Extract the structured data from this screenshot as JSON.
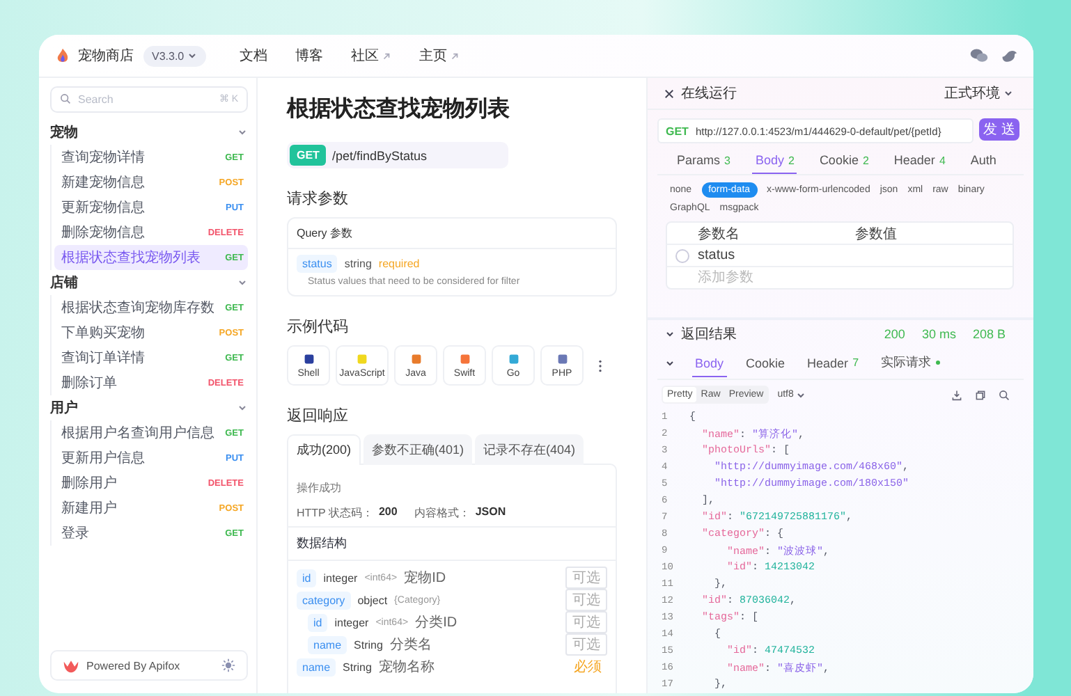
{
  "header": {
    "title": "宠物商店",
    "version": "V3.3.0",
    "nav": [
      {
        "label": "文档",
        "external": false
      },
      {
        "label": "博客",
        "external": false
      },
      {
        "label": "社区",
        "external": true
      },
      {
        "label": "主页",
        "external": true
      }
    ]
  },
  "sidebar": {
    "search": {
      "placeholder": "Search",
      "shortcut": "⌘ K"
    },
    "groups": [
      {
        "title": "宠物",
        "expanded": true,
        "items": [
          {
            "label": "查询宠物详情",
            "method": "GET",
            "color": "#3fb950",
            "selected": false
          },
          {
            "label": "新建宠物信息",
            "method": "POST",
            "color": "#f5a623",
            "selected": false
          },
          {
            "label": "更新宠物信息",
            "method": "PUT",
            "color": "#3b8ff0",
            "selected": false
          },
          {
            "label": "删除宠物信息",
            "method": "DELETE",
            "color": "#f2546b",
            "selected": false
          },
          {
            "label": "根据状态查找宠物列表",
            "method": "GET",
            "color": "#3fb950",
            "selected": true
          }
        ]
      },
      {
        "title": "店铺",
        "expanded": true,
        "items": [
          {
            "label": "根据状态查询宠物库存数",
            "method": "GET",
            "color": "#3fb950",
            "selected": false
          },
          {
            "label": "下单购买宠物",
            "method": "POST",
            "color": "#f5a623",
            "selected": false
          },
          {
            "label": "查询订单详情",
            "method": "GET",
            "color": "#3fb950",
            "selected": false
          },
          {
            "label": "删除订单",
            "method": "DELETE",
            "color": "#f2546b",
            "selected": false
          }
        ]
      },
      {
        "title": "用户",
        "expanded": true,
        "items": [
          {
            "label": "根据用户名查询用户信息",
            "method": "GET",
            "color": "#3fb950",
            "selected": false
          },
          {
            "label": "更新用户信息",
            "method": "PUT",
            "color": "#3b8ff0",
            "selected": false
          },
          {
            "label": "删除用户",
            "method": "DELETE",
            "color": "#f2546b",
            "selected": false
          },
          {
            "label": "新建用户",
            "method": "POST",
            "color": "#f5a623",
            "selected": false
          },
          {
            "label": "登录",
            "method": "GET",
            "color": "#3fb950",
            "selected": false
          }
        ]
      }
    ],
    "footer": "Powered By Apifox"
  },
  "doc": {
    "title": "根据状态查找宠物列表",
    "method": "GET",
    "path": "/pet/findByStatus",
    "params_heading": "请求参数",
    "query_title": "Query 参数",
    "params": [
      {
        "name": "status",
        "type": "string",
        "requirement": "required",
        "description": "Status values that need to be considered for filter"
      }
    ],
    "code_heading": "示例代码",
    "languages": [
      "Shell",
      "JavaScript",
      "Java",
      "Swift",
      "Go",
      "PHP"
    ],
    "response_heading": "返回响应",
    "response_tabs": [
      {
        "label": "成功(200)",
        "selected": true
      },
      {
        "label": "参数不正确(401)",
        "selected": false
      },
      {
        "label": "记录不存在(404)",
        "selected": false
      }
    ],
    "response_desc": "操作成功",
    "status_label": "HTTP 状态码：",
    "status_value": "200",
    "format_label": "内容格式：",
    "format_value": "JSON",
    "schema_heading": "数据结构",
    "fields": [
      {
        "name": "id",
        "type": "integer",
        "format": "<int64>",
        "description": "宠物ID",
        "requirement": "可选",
        "required": false
      },
      {
        "name": "category",
        "type": "object",
        "format": "{Category}",
        "requirement": "可选",
        "required": false,
        "children": [
          {
            "name": "id",
            "type": "integer",
            "format": "<int64>",
            "description": "分类ID",
            "requirement": "可选",
            "required": false
          },
          {
            "name": "name",
            "type": "String",
            "description": "分类名",
            "requirement": "可选",
            "required": false
          }
        ]
      },
      {
        "name": "name",
        "type": "String",
        "description": "宠物名称",
        "requirement": "必须",
        "required": true
      }
    ]
  },
  "run": {
    "title": "在线运行",
    "environment": "正式环境",
    "method": "GET",
    "url": "http://127.0.0.1:4523/m1/444629-0-default/pet/{petId}",
    "send": "发 送",
    "tabs": [
      {
        "label": "Params",
        "count": "3",
        "selected": false
      },
      {
        "label": "Body",
        "count": "2",
        "selected": true
      },
      {
        "label": "Cookie",
        "count": "2",
        "selected": false
      },
      {
        "label": "Header",
        "count": "4",
        "selected": false
      },
      {
        "label": "Auth",
        "selected": false
      }
    ],
    "body_types": [
      {
        "label": "none",
        "selected": false
      },
      {
        "label": "form-data",
        "selected": true
      },
      {
        "label": "x-www-form-urlencoded",
        "selected": false
      },
      {
        "label": "json",
        "selected": false
      },
      {
        "label": "xml",
        "selected": false
      },
      {
        "label": "raw",
        "selected": false
      },
      {
        "label": "binary",
        "selected": false
      },
      {
        "label": "GraphQL",
        "selected": false
      },
      {
        "label": "msgpack",
        "selected": false
      }
    ],
    "table": {
      "columns": [
        "参数名",
        "参数值"
      ],
      "rows": [
        {
          "name": "status",
          "checked": false
        }
      ],
      "add_placeholder": "添加参数"
    },
    "result": {
      "title": "返回结果",
      "expanded": true,
      "status": "200",
      "time": "30 ms",
      "size": "208 B",
      "tabs": [
        {
          "label": "Body",
          "selected": true
        },
        {
          "label": "Cookie",
          "selected": false
        },
        {
          "label": "Header",
          "count": "7",
          "selected": false
        },
        {
          "label": "实际请求",
          "dot": true,
          "selected": false
        }
      ],
      "views": [
        {
          "label": "Pretty",
          "selected": true
        },
        {
          "label": "Raw",
          "selected": false
        },
        {
          "label": "Preview",
          "selected": false
        }
      ],
      "encoding": "utf8",
      "lines": [
        {
          "number": "1",
          "tokens": [
            {
              "kind": "punct",
              "text": "{"
            }
          ]
        },
        {
          "number": "2",
          "tokens": [
            {
              "kind": "key",
              "text": "  \"name\""
            },
            {
              "kind": "punct",
              "text": ": "
            },
            {
              "kind": "string",
              "text": "\"算济化\""
            },
            {
              "kind": "punct",
              "text": ","
            }
          ]
        },
        {
          "number": "3",
          "tokens": [
            {
              "kind": "key",
              "text": "  \"photoUrls\""
            },
            {
              "kind": "punct",
              "text": ": ["
            }
          ]
        },
        {
          "number": "4",
          "tokens": [
            {
              "kind": "string",
              "text": "    \"http://dummyimage.com/468x60\""
            },
            {
              "kind": "punct",
              "text": ","
            }
          ]
        },
        {
          "number": "5",
          "tokens": [
            {
              "kind": "string",
              "text": "    \"http://dummyimage.com/180x150\""
            }
          ]
        },
        {
          "number": "6",
          "tokens": [
            {
              "kind": "punct",
              "text": "  ],"
            }
          ]
        },
        {
          "number": "7",
          "tokens": [
            {
              "kind": "key",
              "text": "  \"id\""
            },
            {
              "kind": "punct",
              "text": ": "
            },
            {
              "kind": "number",
              "text": "\"672149725881176\""
            },
            {
              "kind": "punct",
              "text": ","
            }
          ]
        },
        {
          "number": "8",
          "tokens": [
            {
              "kind": "key",
              "text": "  \"category\""
            },
            {
              "kind": "punct",
              "text": ": {"
            }
          ]
        },
        {
          "number": "9",
          "tokens": [
            {
              "kind": "key",
              "text": "      \"name\""
            },
            {
              "kind": "punct",
              "text": ": "
            },
            {
              "kind": "string",
              "text": "\"波波球\""
            },
            {
              "kind": "punct",
              "text": ","
            }
          ]
        },
        {
          "number": "10",
          "tokens": [
            {
              "kind": "key",
              "text": "      \"id\""
            },
            {
              "kind": "punct",
              "text": ": "
            },
            {
              "kind": "number",
              "text": "14213042"
            }
          ]
        },
        {
          "number": "11",
          "tokens": [
            {
              "kind": "punct",
              "text": "    },"
            }
          ]
        },
        {
          "number": "12",
          "tokens": [
            {
              "kind": "key",
              "text": "  \"id\""
            },
            {
              "kind": "punct",
              "text": ": "
            },
            {
              "kind": "number",
              "text": "87036042"
            },
            {
              "kind": "punct",
              "text": ","
            }
          ]
        },
        {
          "number": "13",
          "tokens": [
            {
              "kind": "key",
              "text": "  \"tags\""
            },
            {
              "kind": "punct",
              "text": ": ["
            }
          ]
        },
        {
          "number": "14",
          "tokens": [
            {
              "kind": "punct",
              "text": "    {"
            }
          ]
        },
        {
          "number": "15",
          "tokens": [
            {
              "kind": "key",
              "text": "      \"id\""
            },
            {
              "kind": "punct",
              "text": ": "
            },
            {
              "kind": "number",
              "text": "47474532"
            }
          ]
        },
        {
          "number": "16",
          "tokens": [
            {
              "kind": "key",
              "text": "      \"name\""
            },
            {
              "kind": "punct",
              "text": ": "
            },
            {
              "kind": "string",
              "text": "\"喜皮虾\""
            },
            {
              "kind": "punct",
              "text": ","
            }
          ]
        },
        {
          "number": "17",
          "tokens": [
            {
              "kind": "punct",
              "text": "    },"
            }
          ]
        }
      ]
    }
  }
}
